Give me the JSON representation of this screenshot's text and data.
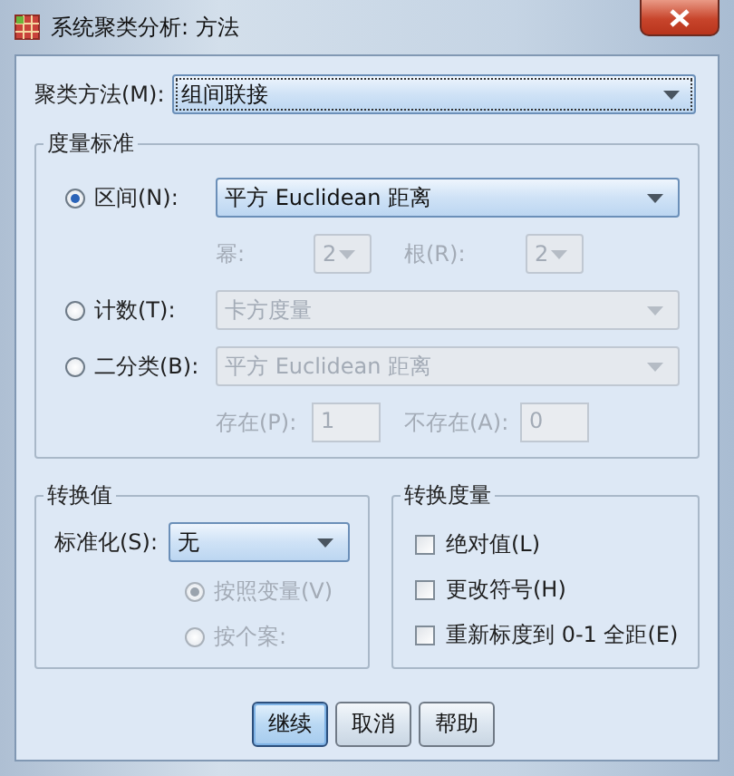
{
  "window": {
    "title": "系统聚类分析: 方法"
  },
  "method": {
    "label": "聚类方法(M):",
    "value": "组间联接"
  },
  "measure": {
    "title": "度量标准",
    "options": [
      {
        "label": "区间(N):",
        "selected": true,
        "value": "平方 Euclidean 距离",
        "disabled": false,
        "params": [
          {
            "kind": "dropdown",
            "label": "幂:",
            "value": "2",
            "disabled": true
          },
          {
            "kind": "dropdown",
            "label": "根(R):",
            "value": "2",
            "disabled": true
          }
        ]
      },
      {
        "label": "计数(T):",
        "selected": false,
        "value": "卡方度量",
        "disabled": true
      },
      {
        "label": "二分类(B):",
        "selected": false,
        "value": "平方 Euclidean 距离",
        "disabled": true,
        "params": [
          {
            "kind": "field",
            "label": "存在(P):",
            "value": "1",
            "disabled": true
          },
          {
            "kind": "field",
            "label": "不存在(A):",
            "value": "0",
            "disabled": true
          }
        ]
      }
    ]
  },
  "transform_values": {
    "title": "转换值",
    "standardize": {
      "label": "标准化(S):",
      "value": "无",
      "disabled": false
    },
    "options": [
      {
        "label": "按照变量(V)",
        "selected": true,
        "disabled": true
      },
      {
        "label": "按个案:",
        "selected": false,
        "disabled": true
      }
    ]
  },
  "transform_measures": {
    "title": "转换度量",
    "options": [
      {
        "label": "绝对值(L)",
        "checked": false
      },
      {
        "label": "更改符号(H)",
        "checked": false
      },
      {
        "label": "重新标度到 0-1 全距(E)",
        "checked": false
      }
    ]
  },
  "buttons": [
    {
      "label": "继续",
      "default": true
    },
    {
      "label": "取消",
      "default": false
    },
    {
      "label": "帮助",
      "default": false
    }
  ]
}
